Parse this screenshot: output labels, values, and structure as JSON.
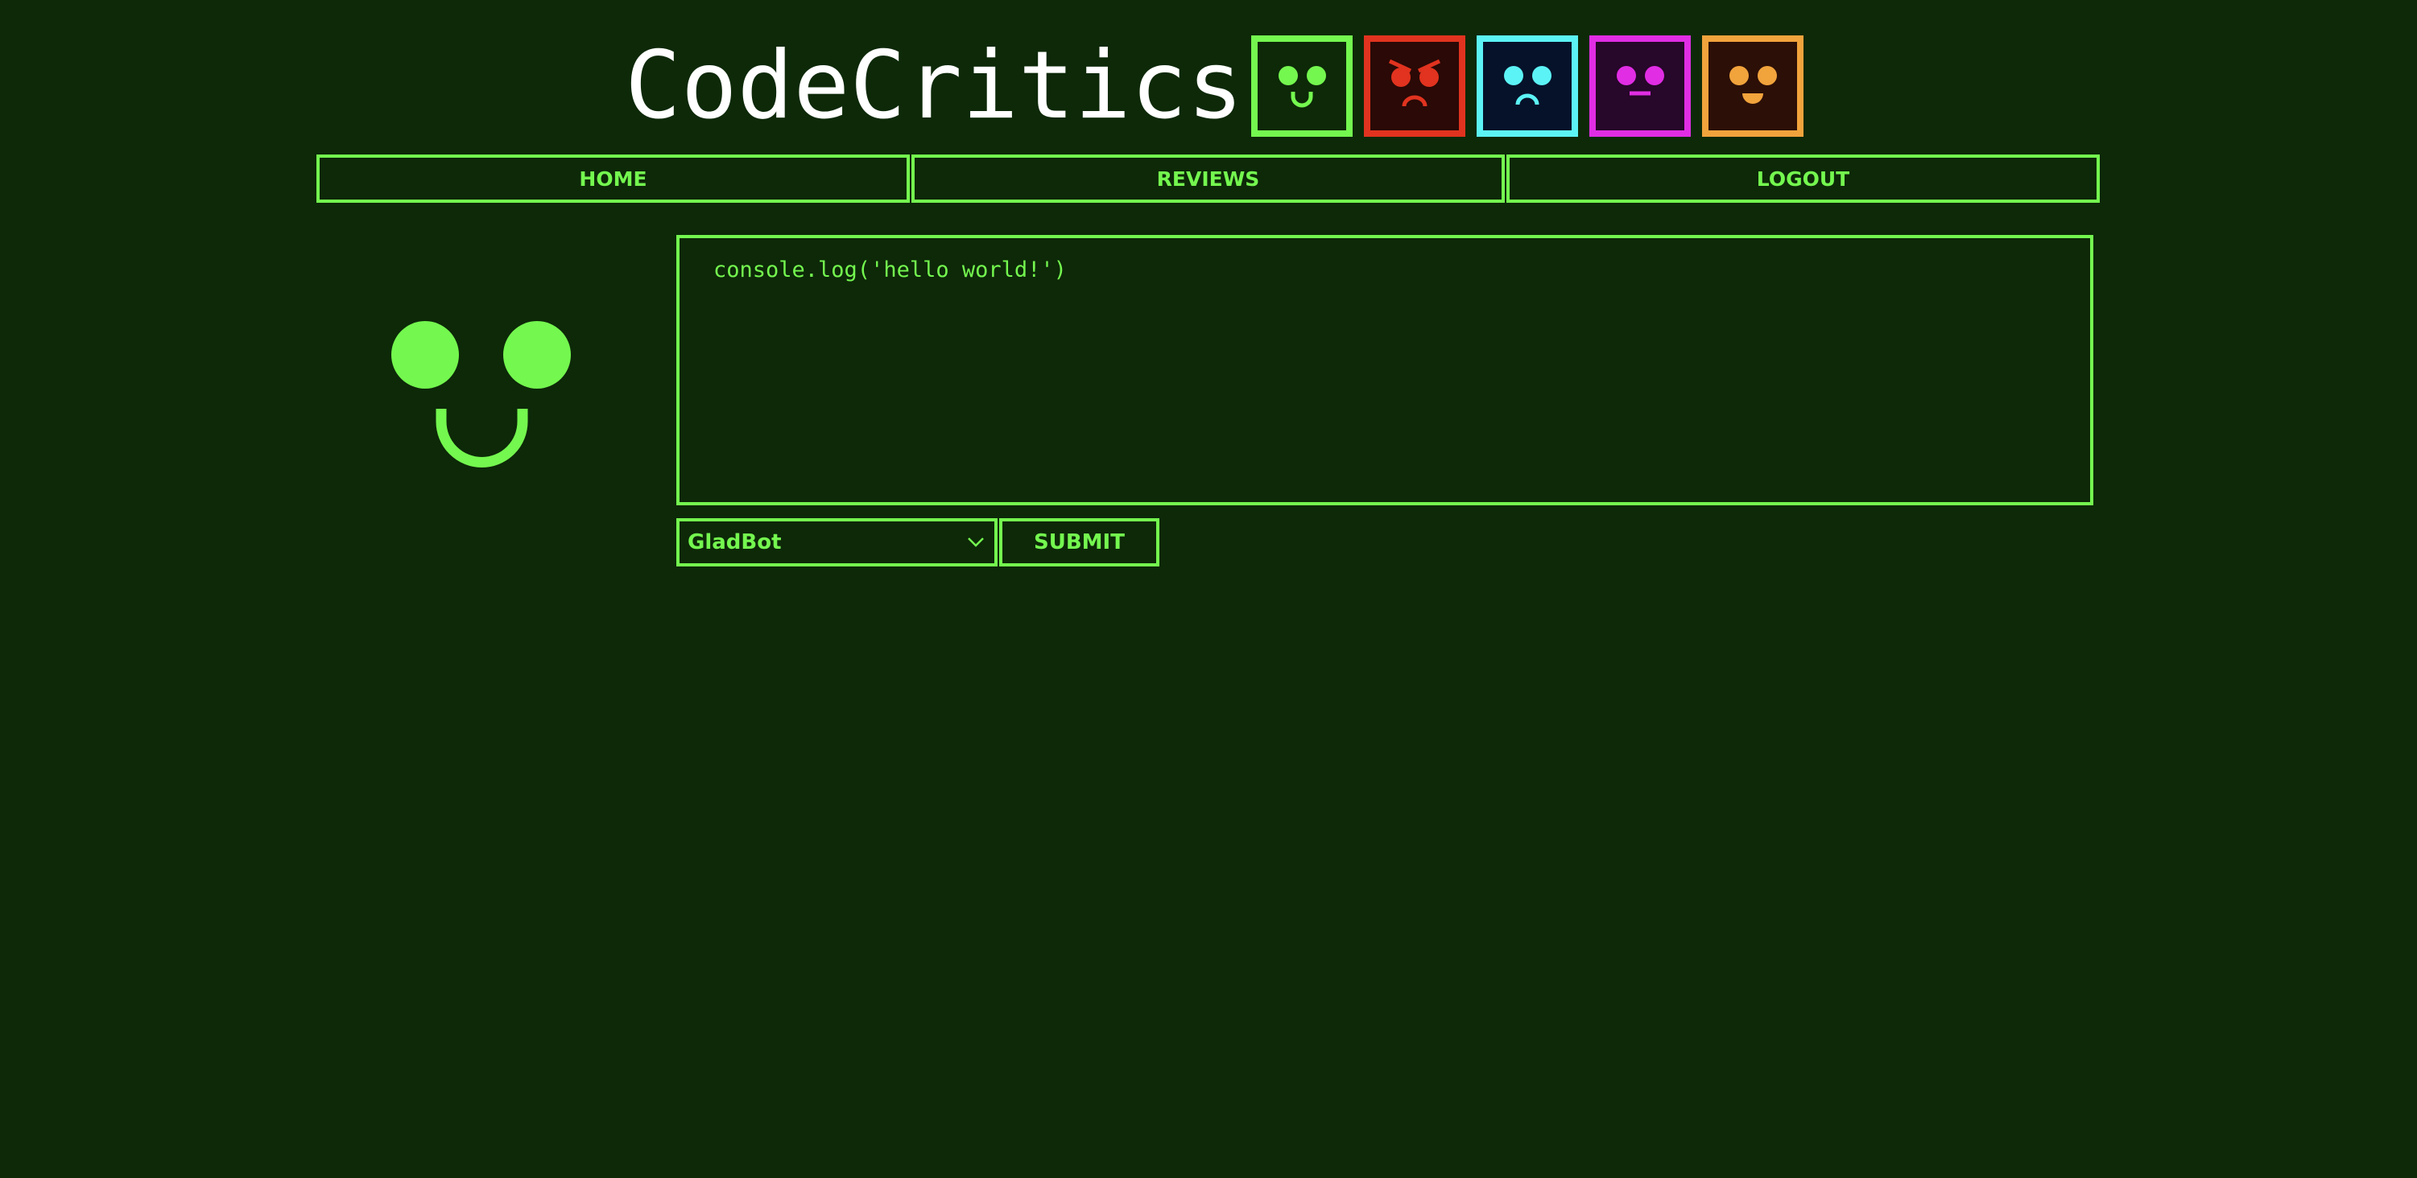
{
  "app": {
    "title": "CodeCritics"
  },
  "colors": {
    "background": "#0d2908",
    "accent": "#74f74f"
  },
  "header": {
    "faces": [
      {
        "icon": "happy-face-icon",
        "mood": "happy",
        "border": "#74f74f",
        "bg": "#0d2908",
        "fg": "#74f74f"
      },
      {
        "icon": "angry-face-icon",
        "mood": "angry",
        "border": "#e1331f",
        "bg": "#2a0906",
        "fg": "#e1331f"
      },
      {
        "icon": "sad-face-icon",
        "mood": "sad",
        "border": "#5cf3f6",
        "bg": "#06122a",
        "fg": "#5cf3f6"
      },
      {
        "icon": "neutral-face-icon",
        "mood": "neutral",
        "border": "#e12de4",
        "bg": "#27072a",
        "fg": "#e12de4"
      },
      {
        "icon": "grin-face-icon",
        "mood": "grin",
        "border": "#f1a33c",
        "bg": "#2c0f07",
        "fg": "#f1a33c"
      }
    ]
  },
  "nav": {
    "home": "HOME",
    "reviews": "REVIEWS",
    "logout": "LOGOUT"
  },
  "bot_face": {
    "icon": "happy-bot-face-icon",
    "color": "#74f74f"
  },
  "editor": {
    "value": "console.log('hello world!')"
  },
  "controls": {
    "selected_bot": "GladBot",
    "submit_label": "SUBMIT",
    "chevron_icon": "chevron-down-icon"
  }
}
